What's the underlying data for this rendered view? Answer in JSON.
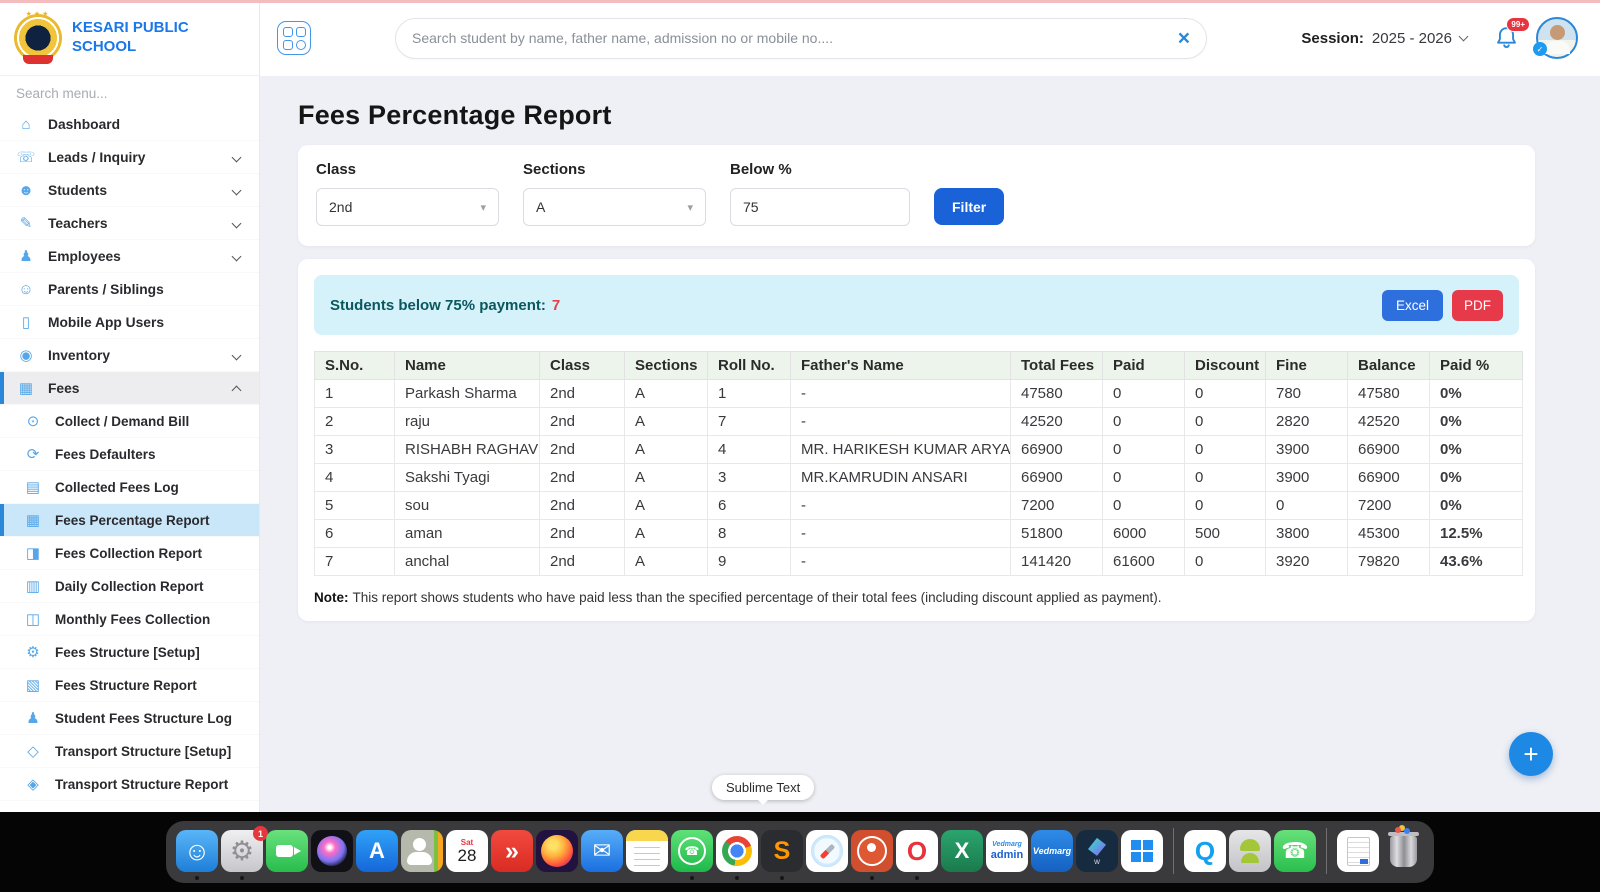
{
  "colors": {
    "accent_blue": "#2b87d8",
    "filter_button_blue": "#1a62d8",
    "excel_button_blue": "#2d6fdd",
    "pdf_button_red": "#e63a4a",
    "banner_bg": "#d5f1f9",
    "banner_text": "#0a585e",
    "value_red": "#e2404b",
    "value_amber": "#f0a91e",
    "table_header_green": "#edf4ec",
    "sidebar_active_bg": "#c9e7f8"
  },
  "sidebar": {
    "school_name": "KESARI PUBLIC SCHOOL",
    "search_placeholder": "Search menu...",
    "items": [
      {
        "id": "dashboard",
        "label": "Dashboard",
        "glyph": "⌂",
        "expandable": false
      },
      {
        "id": "leads-inquiry",
        "label": "Leads / Inquiry",
        "glyph": "☏",
        "expandable": true
      },
      {
        "id": "students",
        "label": "Students",
        "glyph": "☻",
        "expandable": true
      },
      {
        "id": "teachers",
        "label": "Teachers",
        "glyph": "✎",
        "expandable": true
      },
      {
        "id": "employees",
        "label": "Employees",
        "glyph": "♟",
        "expandable": true
      },
      {
        "id": "parents-siblings",
        "label": "Parents / Siblings",
        "glyph": "☺",
        "expandable": false
      },
      {
        "id": "mobile-app-users",
        "label": "Mobile App Users",
        "glyph": "▯",
        "expandable": false
      },
      {
        "id": "inventory",
        "label": "Inventory",
        "glyph": "◉",
        "expandable": true
      },
      {
        "id": "fees",
        "label": "Fees",
        "glyph": "▦",
        "expandable": true,
        "expanded": true,
        "active": true,
        "children": [
          {
            "id": "collect-demand-bill",
            "label": "Collect / Demand Bill",
            "glyph": "⊙"
          },
          {
            "id": "fees-defaulters",
            "label": "Fees Defaulters",
            "glyph": "⟳"
          },
          {
            "id": "collected-fees-log",
            "label": "Collected Fees Log",
            "glyph": "▤"
          },
          {
            "id": "fees-percentage-report",
            "label": "Fees Percentage Report",
            "glyph": "▦",
            "active": true
          },
          {
            "id": "fees-collection-report",
            "label": "Fees Collection Report",
            "glyph": "◨"
          },
          {
            "id": "daily-collection-report",
            "label": "Daily Collection Report",
            "glyph": "▥"
          },
          {
            "id": "monthly-fees-collection",
            "label": "Monthly Fees Collection",
            "glyph": "◫"
          },
          {
            "id": "fees-structure-setup",
            "label": "Fees Structure [Setup]",
            "glyph": "⚙"
          },
          {
            "id": "fees-structure-report",
            "label": "Fees Structure Report",
            "glyph": "▧"
          },
          {
            "id": "student-fees-structure-log",
            "label": "Student Fees Structure Log",
            "glyph": "♟"
          },
          {
            "id": "transport-structure-setup",
            "label": "Transport Structure [Setup]",
            "glyph": "◇"
          },
          {
            "id": "transport-structure-report",
            "label": "Transport Structure Report",
            "glyph": "◈"
          }
        ]
      }
    ]
  },
  "topbar": {
    "search_placeholder": "Search student by name, father name, admission no or mobile no....",
    "session_label": "Session:",
    "session_value": "2025 - 2026",
    "bell_badge": "99+"
  },
  "main": {
    "title": "Fees Percentage Report",
    "filters": {
      "class_label": "Class",
      "class_value": "2nd",
      "sections_label": "Sections",
      "sections_value": "A",
      "below_label": "Below %",
      "below_value": "75",
      "filter_label": "Filter"
    },
    "banner": {
      "text": "Students below 75% payment:",
      "count": "7",
      "excel_label": "Excel",
      "pdf_label": "PDF"
    },
    "table": {
      "headers": [
        "S.No.",
        "Name",
        "Class",
        "Sections",
        "Roll No.",
        "Father's Name",
        "Total Fees",
        "Paid",
        "Discount",
        "Fine",
        "Balance",
        "Paid %"
      ],
      "rows": [
        {
          "sno": "1",
          "name": "Parkash Sharma",
          "cls": "2nd",
          "sec": "A",
          "roll": "1",
          "father": "-",
          "total": "47580",
          "paid": "0",
          "discount": "0",
          "fine": "780",
          "balance": "47580",
          "pct": "0%",
          "pct_color": "red"
        },
        {
          "sno": "2",
          "name": "raju",
          "cls": "2nd",
          "sec": "A",
          "roll": "7",
          "father": "-",
          "total": "42520",
          "paid": "0",
          "discount": "0",
          "fine": "2820",
          "balance": "42520",
          "pct": "0%",
          "pct_color": "red"
        },
        {
          "sno": "3",
          "name": "RISHABH RAGHAV",
          "cls": "2nd",
          "sec": "A",
          "roll": "4",
          "father": "MR. HARIKESH KUMAR ARYA",
          "total": "66900",
          "paid": "0",
          "discount": "0",
          "fine": "3900",
          "balance": "66900",
          "pct": "0%",
          "pct_color": "red"
        },
        {
          "sno": "4",
          "name": "Sakshi Tyagi",
          "cls": "2nd",
          "sec": "A",
          "roll": "3",
          "father": "MR.KAMRUDIN ANSARI",
          "total": "66900",
          "paid": "0",
          "discount": "0",
          "fine": "3900",
          "balance": "66900",
          "pct": "0%",
          "pct_color": "red"
        },
        {
          "sno": "5",
          "name": "sou",
          "cls": "2nd",
          "sec": "A",
          "roll": "6",
          "father": "-",
          "total": "7200",
          "paid": "0",
          "discount": "0",
          "fine": "0",
          "balance": "7200",
          "pct": "0%",
          "pct_color": "red"
        },
        {
          "sno": "6",
          "name": "aman",
          "cls": "2nd",
          "sec": "A",
          "roll": "8",
          "father": "-",
          "total": "51800",
          "paid": "6000",
          "discount": "500",
          "fine": "3800",
          "balance": "45300",
          "pct": "12.5%",
          "pct_color": "red"
        },
        {
          "sno": "7",
          "name": "anchal",
          "cls": "2nd",
          "sec": "A",
          "roll": "9",
          "father": "-",
          "total": "141420",
          "paid": "61600",
          "discount": "0",
          "fine": "3920",
          "balance": "79820",
          "pct": "43.6%",
          "pct_color": "amber"
        }
      ]
    },
    "note_label": "Note:",
    "note_text": "This report shows students who have paid less than the specified percentage of their total fees (including discount applied as payment).",
    "fab_label": "+"
  },
  "tooltip": {
    "label": "Sublime Text"
  },
  "dock": {
    "items": [
      {
        "name": "finder-icon",
        "kind": "finder",
        "running": true
      },
      {
        "name": "system-settings-icon",
        "kind": "settings",
        "badge": "1",
        "running": true
      },
      {
        "name": "facetime-icon",
        "kind": "facetime"
      },
      {
        "name": "siri-icon",
        "kind": "siri"
      },
      {
        "name": "app-store-icon",
        "kind": "appstore",
        "glyph": "A"
      },
      {
        "name": "contacts-icon",
        "kind": "contacts"
      },
      {
        "name": "calendar-icon",
        "kind": "calendar",
        "dow": "Sat",
        "day": "28"
      },
      {
        "name": "anydesk-icon",
        "kind": "anydesk"
      },
      {
        "name": "firefox-icon",
        "kind": "firefox"
      },
      {
        "name": "mail-icon",
        "kind": "mail"
      },
      {
        "name": "notes-icon",
        "kind": "notes",
        "running": true
      },
      {
        "name": "whatsapp-icon",
        "kind": "whatsapp",
        "running": true
      },
      {
        "name": "chrome-icon",
        "kind": "chrome",
        "running": true
      },
      {
        "name": "sublime-text-icon",
        "kind": "sublime",
        "glyph": "S",
        "running": true
      },
      {
        "name": "safari-icon",
        "kind": "safari"
      },
      {
        "name": "duckduckgo-icon",
        "kind": "ddg",
        "running": true
      },
      {
        "name": "opera-icon",
        "kind": "opera",
        "glyph": "O",
        "running": true
      },
      {
        "name": "excel-icon",
        "kind": "excel",
        "glyph": "X"
      },
      {
        "name": "vedmarg-admin-icon",
        "kind": "vedadmin",
        "line1": "Vedmarg",
        "line2": "admin"
      },
      {
        "name": "vedmarg-icon",
        "kind": "vedmarg",
        "line1": "Vedmarg"
      },
      {
        "name": "filmora-icon",
        "kind": "filmora",
        "letter": "w"
      },
      {
        "name": "windows-icon",
        "kind": "windows"
      },
      {
        "kind": "sep"
      },
      {
        "name": "quicktime-icon",
        "kind": "quicktime",
        "glyph": "Q"
      },
      {
        "name": "android-icon",
        "kind": "android"
      },
      {
        "name": "phone-icon",
        "kind": "phone"
      },
      {
        "kind": "sep"
      },
      {
        "name": "clipboard-icon",
        "kind": "clipboard"
      },
      {
        "name": "trash-icon",
        "kind": "trash"
      }
    ]
  }
}
